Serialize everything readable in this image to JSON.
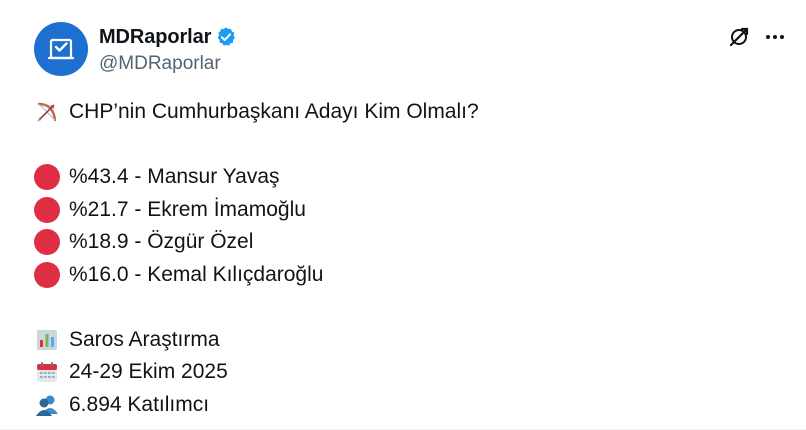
{
  "account": {
    "display_name": "MDRaporlar",
    "handle": "@MDRaporlar",
    "verified": true
  },
  "icons": {
    "avatar": "ballot-box-logo",
    "verified": "verified-badge-icon",
    "grok": "grok-icon",
    "more": "more-dots-icon",
    "title": "bow-and-arrow-emoji",
    "result_marker": "red-circle-emoji",
    "source": "bar-chart-emoji",
    "date": "calendar-emoji",
    "participants": "busts-emoji"
  },
  "tweet": {
    "title": "CHP’nin Cumhurbaşkanı Adayı Kim Olmalı?",
    "results": [
      {
        "label": "%43.4 - Mansur Yavaş"
      },
      {
        "label": "%21.7 - Ekrem İmamoğlu"
      },
      {
        "label": "%18.9 - Özgür Özel"
      },
      {
        "label": "%16.0 - Kemal Kılıçdaroğlu"
      }
    ],
    "source": "Saros Araştırma",
    "date": "24-29 Ekim 2025",
    "participants": "6.894 Katılımcı"
  },
  "colors": {
    "text": "#0f1419",
    "muted": "#536471",
    "brand_blue": "#1d9bf0",
    "avatar_blue": "#1d6fd0",
    "result_red": "#dd2e44"
  }
}
